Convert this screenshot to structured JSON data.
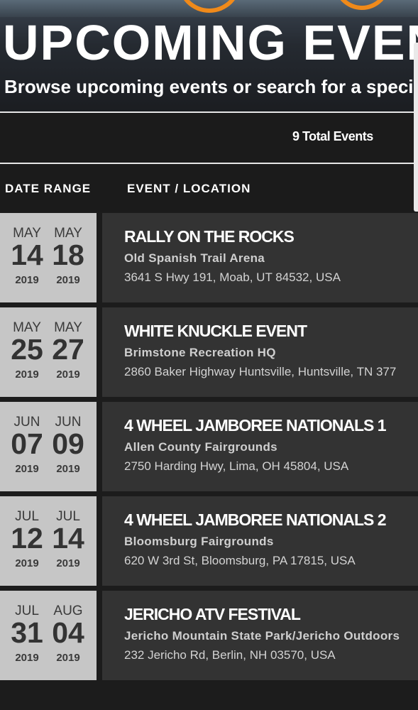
{
  "hero": {
    "title": "UPCOMING EVEN",
    "subtitle": "Browse upcoming events or search for a speci"
  },
  "summary": {
    "total_label": "9 Total Events"
  },
  "columns": {
    "date_range": "DATE RANGE",
    "event_location": "EVENT / LOCATION"
  },
  "events": [
    {
      "start": {
        "month": "MAY",
        "day": "14",
        "year": "2019"
      },
      "end": {
        "month": "MAY",
        "day": "18",
        "year": "2019"
      },
      "name": "RALLY ON THE ROCKS",
      "venue": "Old Spanish Trail Arena",
      "address": "3641 S Hwy 191, Moab, UT 84532, USA"
    },
    {
      "start": {
        "month": "MAY",
        "day": "25",
        "year": "2019"
      },
      "end": {
        "month": "MAY",
        "day": "27",
        "year": "2019"
      },
      "name": "WHITE KNUCKLE EVENT",
      "venue": "Brimstone Recreation HQ",
      "address": "2860 Baker Highway Huntsville, Huntsville, TN 377"
    },
    {
      "start": {
        "month": "JUN",
        "day": "07",
        "year": "2019"
      },
      "end": {
        "month": "JUN",
        "day": "09",
        "year": "2019"
      },
      "name": "4 WHEEL JAMBOREE NATIONALS 1",
      "venue": "Allen County Fairgrounds",
      "address": "2750 Harding Hwy, Lima, OH 45804, USA"
    },
    {
      "start": {
        "month": "JUL",
        "day": "12",
        "year": "2019"
      },
      "end": {
        "month": "JUL",
        "day": "14",
        "year": "2019"
      },
      "name": "4 WHEEL JAMBOREE NATIONALS 2",
      "venue": "Bloomsburg Fairgrounds",
      "address": "620 W 3rd St, Bloomsburg, PA 17815, USA"
    },
    {
      "start": {
        "month": "JUL",
        "day": "31",
        "year": "2019"
      },
      "end": {
        "month": "AUG",
        "day": "04",
        "year": "2019"
      },
      "name": "JERICHO ATV FESTIVAL",
      "venue": "Jericho Mountain State Park/Jericho Outdoors",
      "address": "232 Jericho Rd, Berlin, NH 03570, USA"
    }
  ]
}
